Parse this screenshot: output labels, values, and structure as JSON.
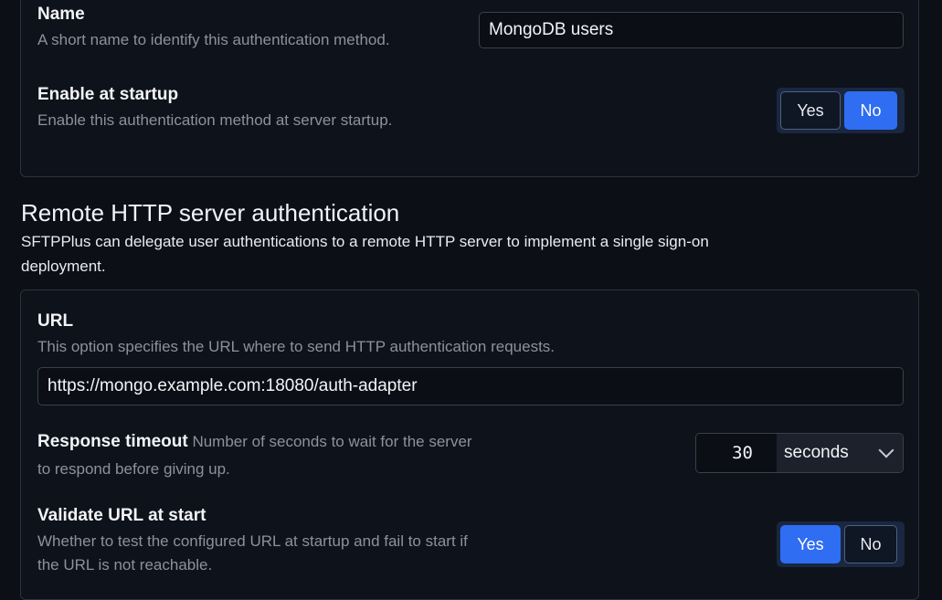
{
  "general": {
    "name": {
      "label": "Name",
      "help": "A short name to identify this authentication method.",
      "value": "MongoDB users"
    },
    "enable_at_startup": {
      "label": "Enable at startup",
      "help": "Enable this authentication method at server startup.",
      "yes_label": "Yes",
      "no_label": "No",
      "selected": "No"
    }
  },
  "http_section": {
    "title": "Remote HTTP server authentication",
    "description": "SFTPPlus can delegate user authentications to a remote HTTP server to implement a single sign-on deployment.",
    "url": {
      "label": "URL",
      "help": "This option specifies the URL where to send HTTP authentication requests.",
      "value": "https://mongo.example.com:18080/auth-adapter"
    },
    "response_timeout": {
      "label": "Response timeout",
      "help": "Number of seconds to wait for the server to respond before giving up.",
      "value": "30",
      "unit": "seconds"
    },
    "validate_url": {
      "label": "Validate URL at start",
      "help": "Whether to test the configured URL at startup and fail to start if the URL is not reachable.",
      "yes_label": "Yes",
      "no_label": "No",
      "selected": "Yes"
    }
  },
  "colors": {
    "accent": "#2f6df2",
    "background": "#0c0f16",
    "panel": "#0e121a"
  },
  "icons": {
    "unit_dropdown": "chevron-down-icon"
  }
}
